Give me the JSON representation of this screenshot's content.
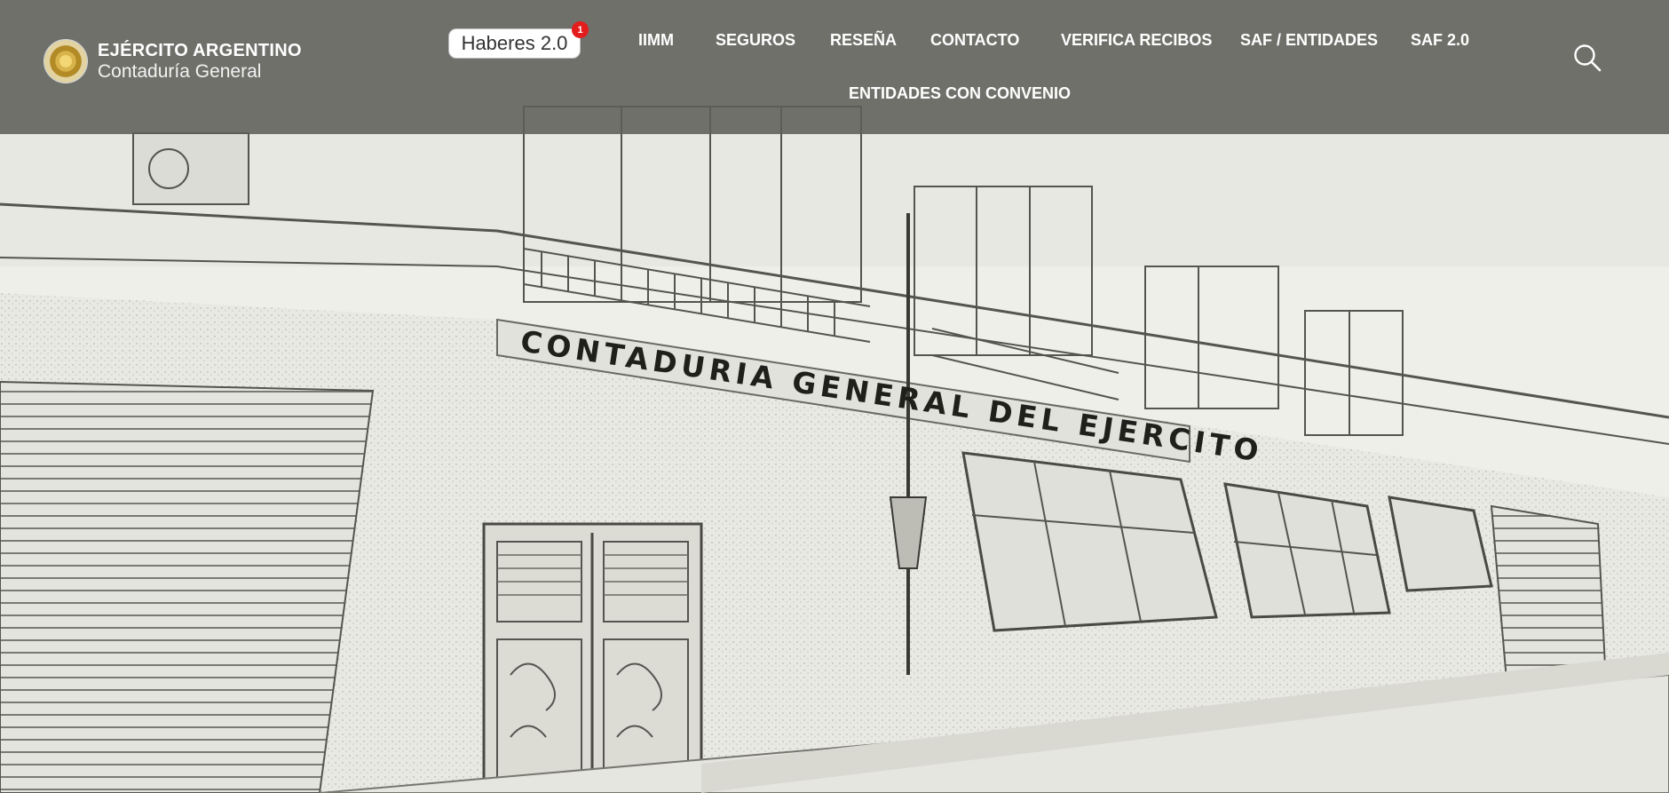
{
  "brand": {
    "title": "EJÉRCITO ARGENTINO",
    "subtitle": "Contaduría General",
    "seal_icon": "army-seal-logo"
  },
  "haberes": {
    "label": "Haberes 2.0",
    "badge_count": "1"
  },
  "nav": {
    "items": [
      {
        "label": "IIMM"
      },
      {
        "label": "SEGUROS"
      },
      {
        "label": "RESEÑA"
      },
      {
        "label": "CONTACTO"
      },
      {
        "label": "VERIFICA RECIBOS"
      },
      {
        "label": "SAF / ENTIDADES"
      },
      {
        "label": "SAF 2.0"
      },
      {
        "label": "ENTIDADES CON CONVENIO"
      }
    ]
  },
  "search": {
    "icon": "search-icon"
  },
  "hero": {
    "building_sign": "CONTADURIA GENERAL DEL EJERCITO"
  },
  "colors": {
    "header_bg": "#5f5f5a",
    "badge": "#e31c1c",
    "hero_bg": "#eeeeea"
  }
}
